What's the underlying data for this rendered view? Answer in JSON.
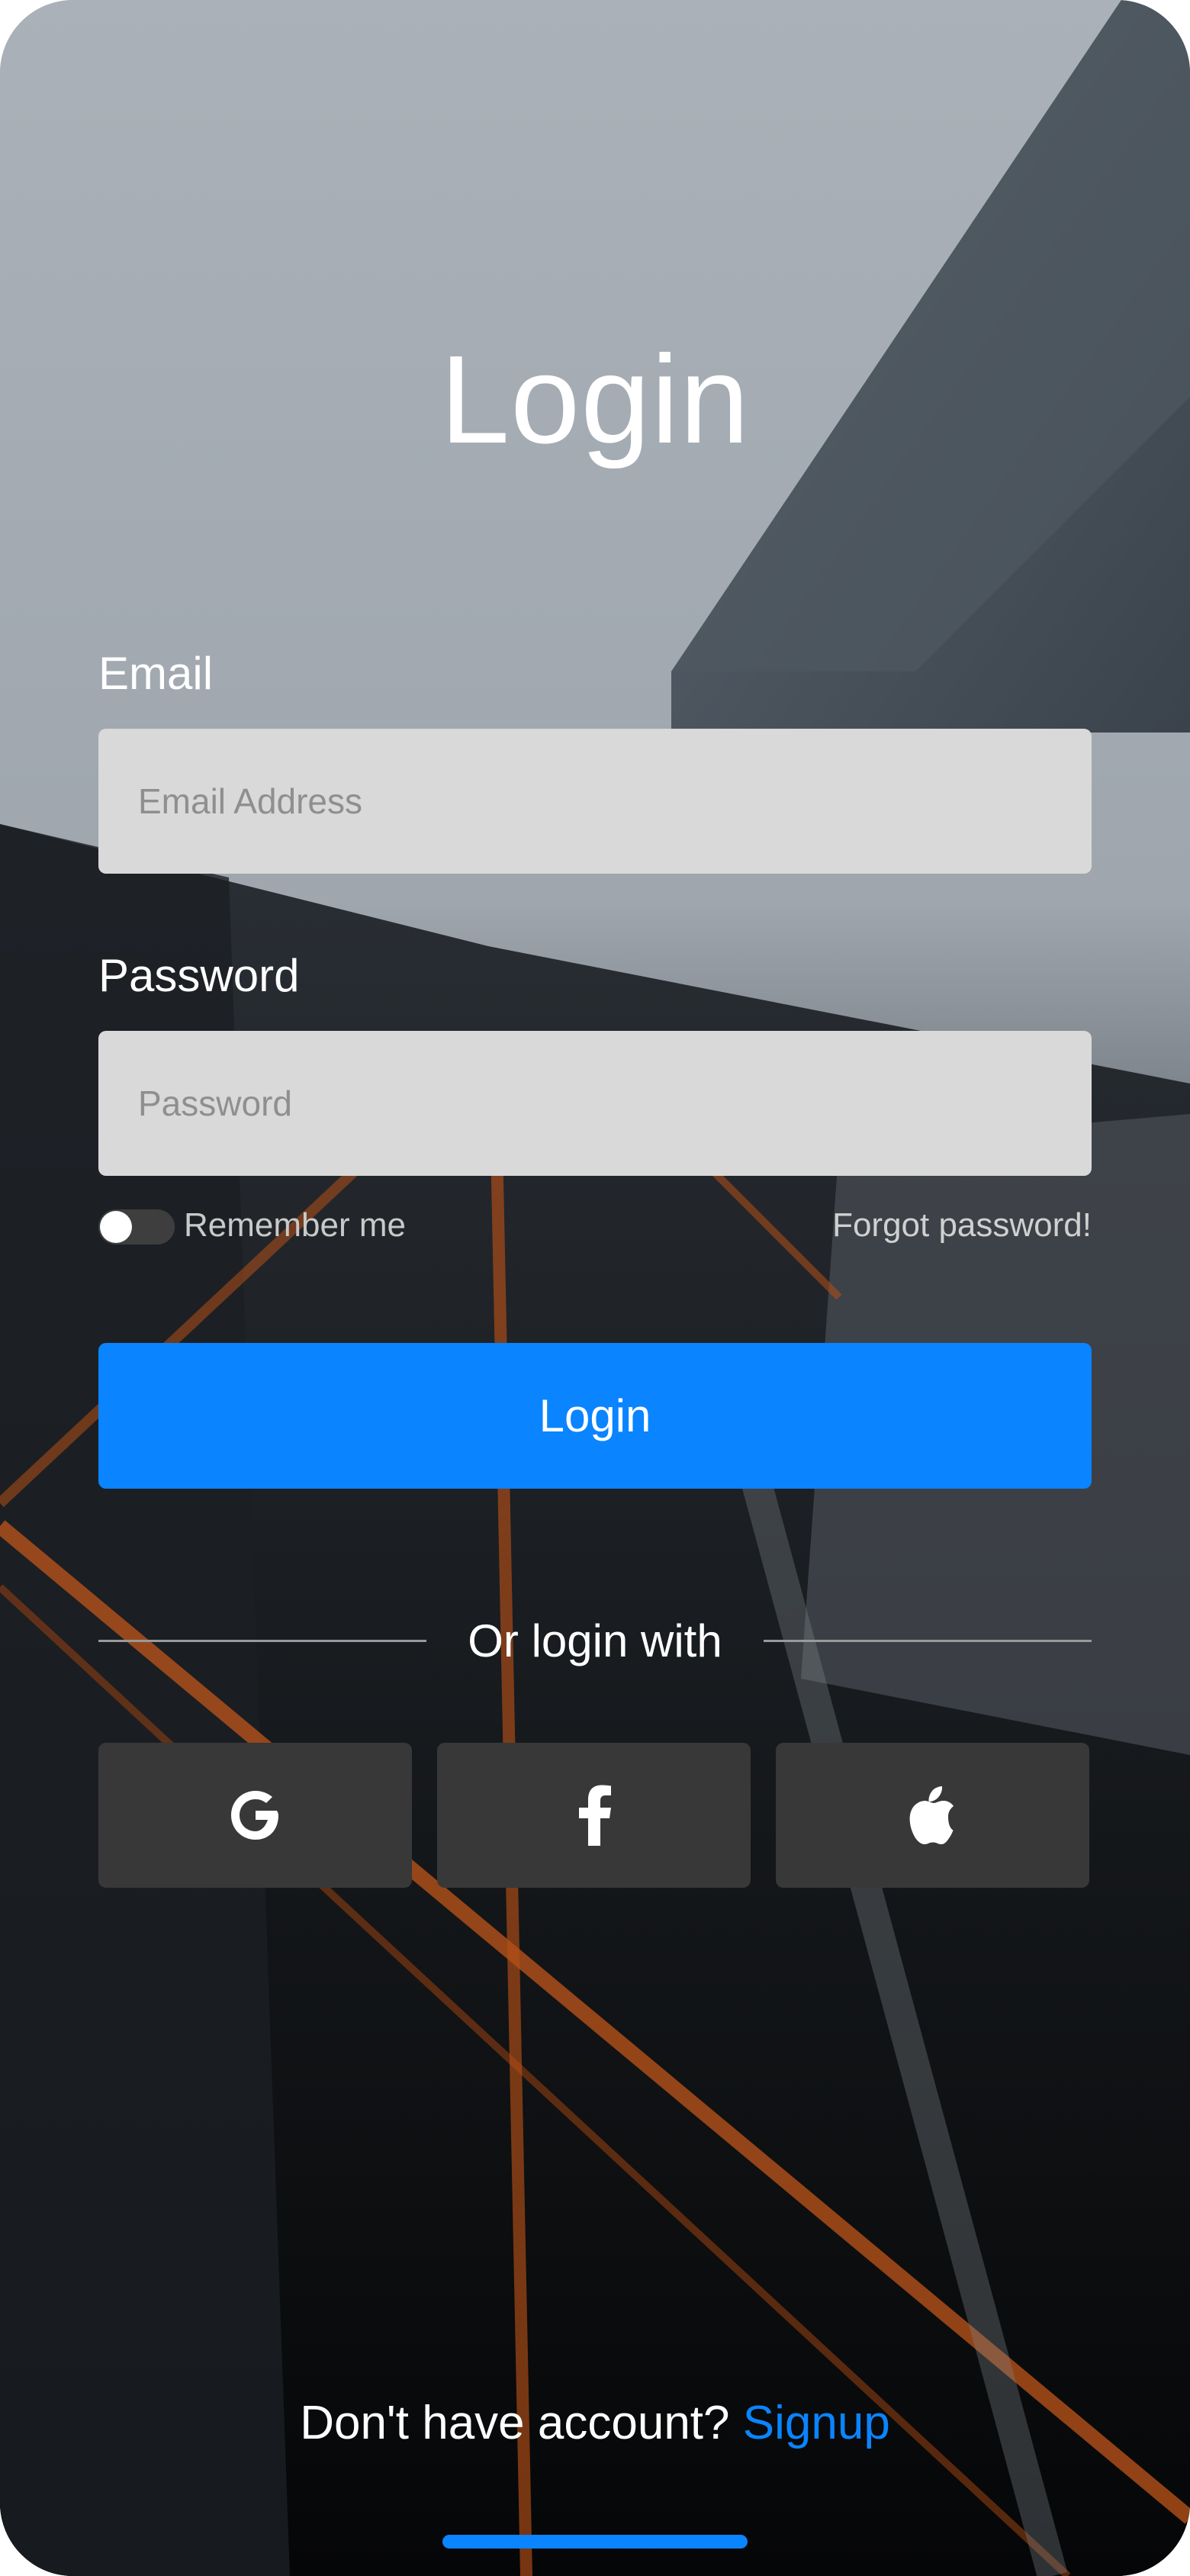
{
  "login": {
    "title": "Login",
    "email_label": "Email",
    "email_placeholder": "Email Address",
    "email_value": "",
    "password_label": "Password",
    "password_placeholder": "Password",
    "password_value": "",
    "remember_label": "Remember me",
    "remember_checked": false,
    "forgot_label": "Forgot password!",
    "submit_label": "Login",
    "divider_text": "Or login with",
    "social": [
      {
        "provider": "google",
        "icon": "google-icon"
      },
      {
        "provider": "facebook",
        "icon": "facebook-icon"
      },
      {
        "provider": "apple",
        "icon": "apple-icon"
      }
    ],
    "signup_prompt": "Don't have account?",
    "signup_link": "Signup"
  },
  "colors": {
    "accent": "#0a84ff",
    "input_bg": "#d9d9d9",
    "social_bg": "#383838",
    "text": "#ffffff"
  }
}
